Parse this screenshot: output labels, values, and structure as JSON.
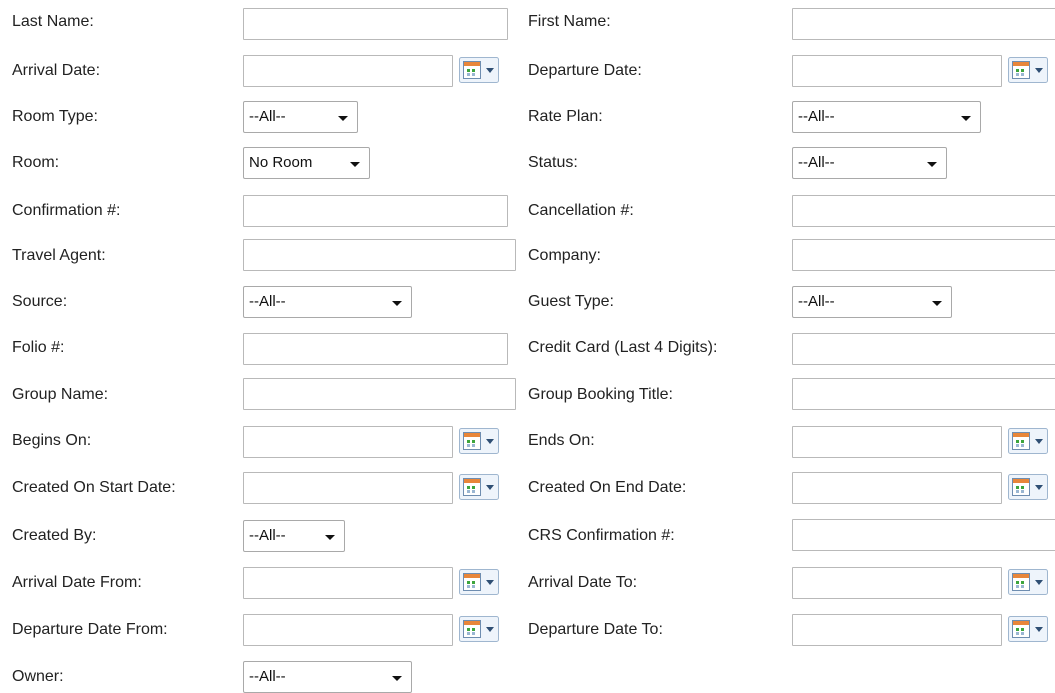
{
  "form": {
    "last_name": {
      "label": "Last Name:",
      "value": ""
    },
    "first_name": {
      "label": "First Name:",
      "value": ""
    },
    "arrival_date": {
      "label": "Arrival Date:",
      "value": ""
    },
    "departure_date": {
      "label": "Departure Date:",
      "value": ""
    },
    "room_type": {
      "label": "Room Type:",
      "selected": "--All--"
    },
    "rate_plan": {
      "label": "Rate Plan:",
      "selected": "--All--"
    },
    "room": {
      "label": "Room:",
      "selected": "No Room"
    },
    "status": {
      "label": "Status:",
      "selected": "--All--"
    },
    "confirmation": {
      "label": "Confirmation #:",
      "value": ""
    },
    "cancellation": {
      "label": "Cancellation #:",
      "value": ""
    },
    "travel_agent": {
      "label": "Travel Agent:",
      "value": ""
    },
    "company": {
      "label": "Company:",
      "value": ""
    },
    "source": {
      "label": "Source:",
      "selected": "--All--"
    },
    "guest_type": {
      "label": "Guest Type:",
      "selected": "--All--"
    },
    "folio": {
      "label": "Folio #:",
      "value": ""
    },
    "credit_card": {
      "label": "Credit Card (Last 4 Digits):",
      "value": ""
    },
    "group_name": {
      "label": "Group Name:",
      "value": ""
    },
    "group_booking_title": {
      "label": "Group Booking Title:",
      "value": ""
    },
    "begins_on": {
      "label": "Begins On:",
      "value": ""
    },
    "ends_on": {
      "label": "Ends On:",
      "value": ""
    },
    "created_on_start": {
      "label": "Created On Start Date:",
      "value": ""
    },
    "created_on_end": {
      "label": "Created On End Date:",
      "value": ""
    },
    "created_by": {
      "label": "Created By:",
      "selected": "--All--"
    },
    "crs_confirmation": {
      "label": "CRS Confirmation #:",
      "value": ""
    },
    "arrival_date_from": {
      "label": "Arrival Date From:",
      "value": ""
    },
    "arrival_date_to": {
      "label": "Arrival Date To:",
      "value": ""
    },
    "departure_date_from": {
      "label": "Departure Date From:",
      "value": ""
    },
    "departure_date_to": {
      "label": "Departure Date To:",
      "value": ""
    },
    "owner": {
      "label": "Owner:",
      "selected": "--All--"
    }
  },
  "icons": {
    "calendar": "calendar-picker-icon",
    "dropdown": "chevron-down-icon"
  },
  "colors": {
    "text": "#222222",
    "input_border": "#b9b9b9",
    "calendar_green": "#3da53d",
    "calendar_orange": "#e8863a"
  }
}
